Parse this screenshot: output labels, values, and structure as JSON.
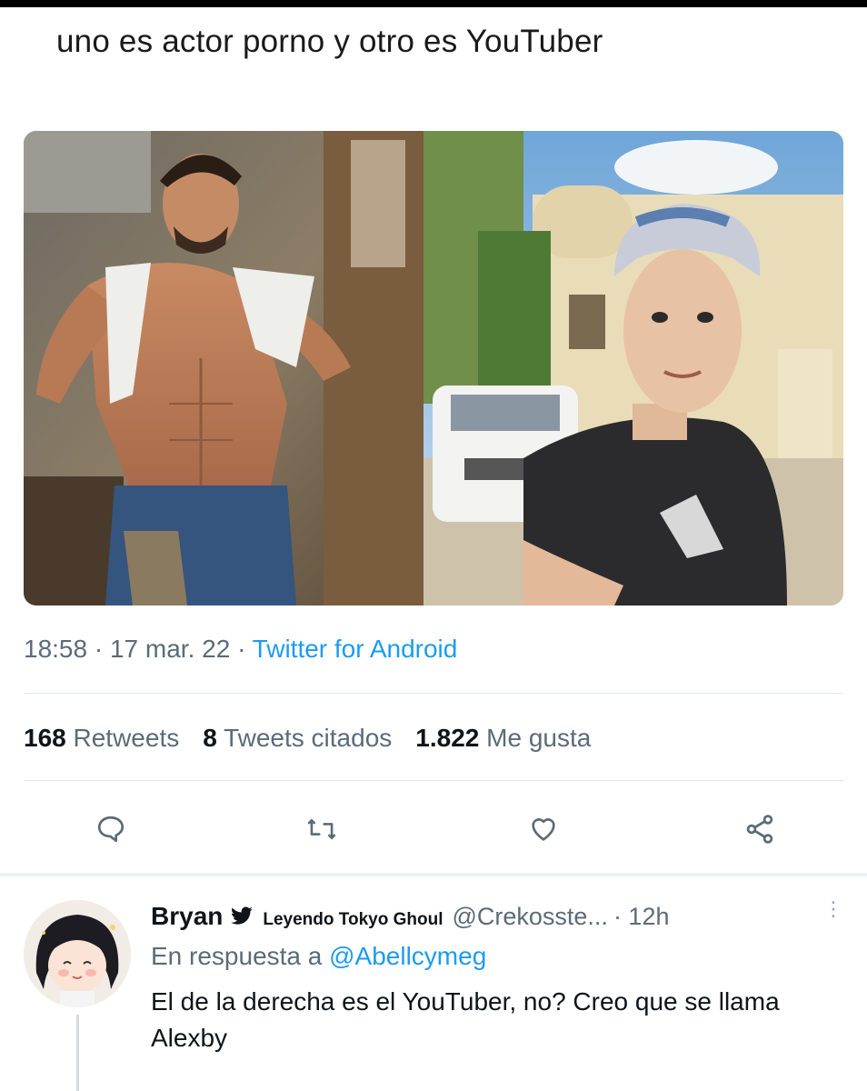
{
  "tweet": {
    "text": "uno es actor porno y otro es YouTuber",
    "time": "18:58",
    "date": "17 mar. 22",
    "source": "Twitter for Android",
    "separator": "·",
    "media": {
      "left_description": "man pulling up white tank top",
      "right_description": "man in cap selfie"
    }
  },
  "stats": {
    "retweets_count": "168",
    "retweets_label": "Retweets",
    "quotes_count": "8",
    "quotes_label": "Tweets citados",
    "likes_count": "1.822",
    "likes_label": "Me gusta"
  },
  "actions": {
    "icons": [
      "reply-icon",
      "retweet-icon",
      "like-icon",
      "share-icon"
    ],
    "icon_color": "#5b6b78"
  },
  "reply": {
    "name": "Bryan",
    "bio_snippet": "Leyendo Tokyo Ghoul",
    "handle": "@Crekosste...",
    "time": "· 12h",
    "reply_prefix": "En respuesta a",
    "reply_mention": "@Abellcymeg",
    "body": "El de la derecha es el YouTuber, no? Creo que se llama Alexby"
  },
  "colors": {
    "accent": "#1d9bf0",
    "muted": "#5b6b78",
    "text": "#0f1419"
  }
}
